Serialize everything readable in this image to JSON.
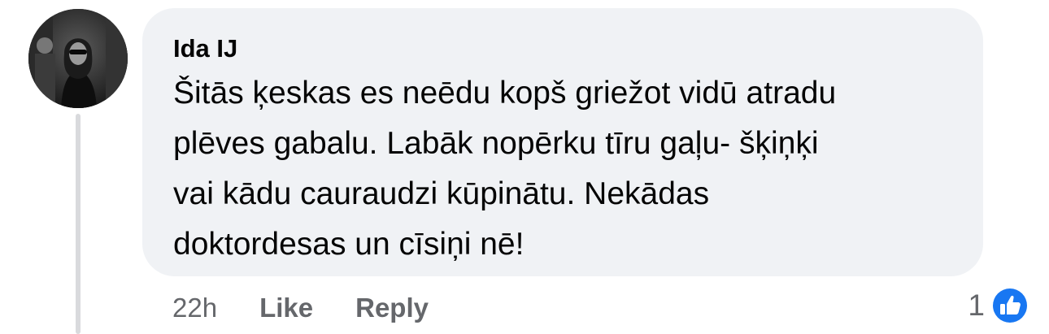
{
  "comment": {
    "author": "Ida IJ",
    "text": "Šitās ķeskas es neēdu kopš griežot vidū atradu\nplēves gabalu. Labāk nopērku tīru gaļu- šķiņķi\nvai kādu cauraudzi kūpinātu. Nekādas\ndoktordesas un cīsiņi nē!",
    "timestamp": "22h",
    "like_label": "Like",
    "reply_label": "Reply",
    "reaction_count": "1",
    "reaction_icon": "like-thumbs-up-icon"
  },
  "colors": {
    "bubble_bg": "#f0f2f5",
    "text": "#050505",
    "secondary_text": "#65676b",
    "like_blue": "#1877f2"
  }
}
